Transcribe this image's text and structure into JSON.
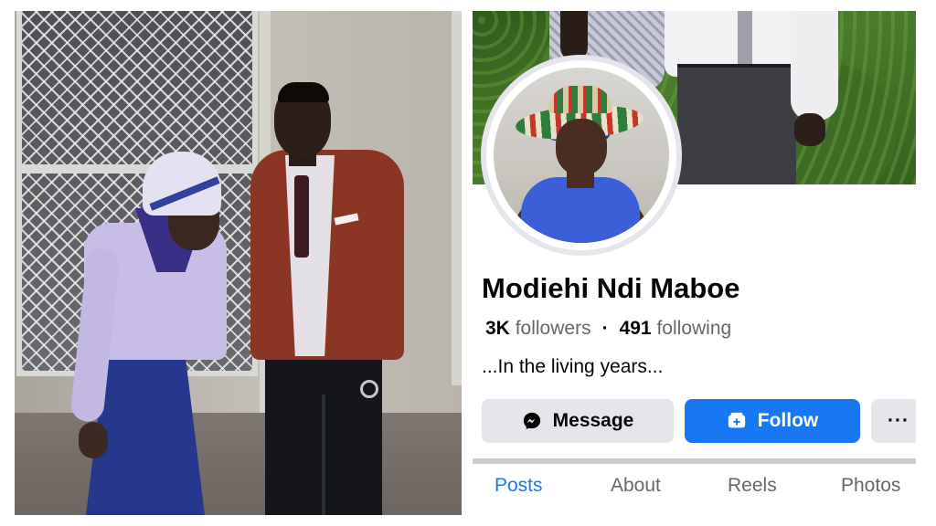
{
  "profile": {
    "name": "Modiehi Ndi Maboe",
    "followers_count": "3K",
    "followers_label": "followers",
    "following_count": "491",
    "following_label": "following",
    "separator": "·",
    "bio": "...In the living years..."
  },
  "actions": {
    "message_label": "Message",
    "message_icon": "messenger-icon",
    "follow_label": "Follow",
    "follow_icon": "add-friend-icon",
    "more_label": "···"
  },
  "tabs": [
    {
      "label": "Posts",
      "active": true
    },
    {
      "label": "About",
      "active": false
    },
    {
      "label": "Reels",
      "active": false
    },
    {
      "label": "Photos",
      "active": false
    }
  ],
  "colors": {
    "accent": "#1877f2",
    "button_secondary": "#e4e6eb",
    "text_primary": "#050505",
    "text_secondary": "#65676b"
  }
}
